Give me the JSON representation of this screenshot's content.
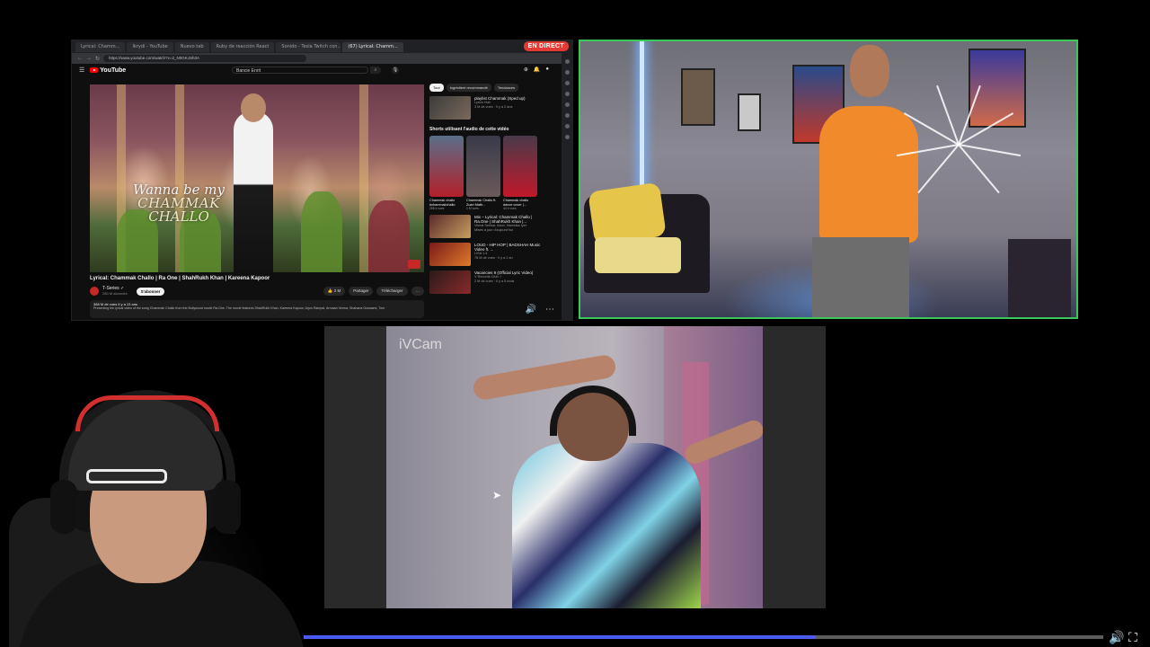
{
  "browser": {
    "tabs": [
      {
        "label": "Lyrical: Chamm..."
      },
      {
        "label": "Ikrydi - YouTube"
      },
      {
        "label": "Nuevo tab"
      },
      {
        "label": "Ruby de reacción React"
      },
      {
        "label": "Sonido - Tesla Twitch con..."
      },
      {
        "label": "(67) Lyrical: Chamm..."
      }
    ],
    "live_badge": "EN DIRECT",
    "url": "https://www.youtube.com/watch?v=2_N0GKJSh3A",
    "search_value": "Bancie Enrit"
  },
  "youtube": {
    "logo_text": "YouTube",
    "video_caption": [
      "Wanna be my",
      "CHAMMAK",
      "CHALLO"
    ],
    "title": "Lyrical: Chammak Challo | Ra One | ShahRukh Khan | Kareena Kapoor",
    "channel": "T-Series ✓",
    "subscribers": "280 M abonnés",
    "subscribe_label": "S'abonner",
    "actions": [
      "👍 2 M",
      "Partager",
      "Télécharger",
      "…"
    ],
    "description_meta": "388 M de vues  Il y a 13 ans",
    "description_text": "Presenting the lyrical video of the song Chammak Challo from the Bollywood movie Ra.One. The movie features ShahRukh Khan, Kareena Kapoor, Arjun Rampal, Armaan Verma, Shahana Goswami, Tom",
    "chips": [
      "Tout",
      "Ingrédient recommandé",
      "Tendances",
      "Liés"
    ],
    "first_rec": {
      "title": "playlist Chammak (Sped up)",
      "channel": "Lyrics Hub",
      "meta": "3 M de vues · Il y a 2 ans"
    },
    "shorts_heading": "Shorts utilisant l'audio de cette vidéo",
    "shorts": [
      {
        "title": "Chammak challo #chammakchallo",
        "views": "256 k vues"
      },
      {
        "title": "Chammak Challo ft. Zuari Math...",
        "views": "1 M vues"
      },
      {
        "title": "Chammak challo dance cover |...",
        "views": "44 k vues"
      }
    ],
    "recs": [
      {
        "title": "Mix – Lyrical: Chammak Challo | Ra.One | ShahRukh Khan |...",
        "channel": "Vishal Sekhar, Akon, Hamsika Iyer",
        "meta": "Mises à jour d'aujourd'hui"
      },
      {
        "title": "LOUD - HIP HOP | BADSHAH Music Video ft. ...",
        "channel": "LISA 1.4",
        "meta": "78 M de vues · Il y a 1 an"
      },
      {
        "title": "Vacancies 9 (Official Lyric Video)",
        "channel": "V Records Club ✓",
        "meta": "2 M de vues · Il y a 5 mois"
      }
    ]
  },
  "cam_center": {
    "watermark": "iVCam"
  },
  "player": {
    "progress": 0.64,
    "volume_icon": "🔊",
    "fullscreen_icon": "⛶"
  },
  "colors": {
    "live_badge": "#e53935",
    "active_cam_border": "#3cc75a",
    "progress_fill": "#4a5cf0",
    "progress_track": "#5c5c5c"
  }
}
